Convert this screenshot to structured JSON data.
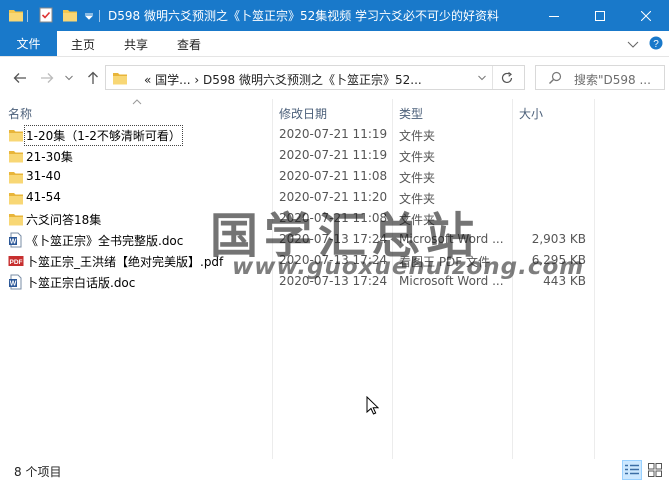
{
  "window": {
    "title": "D598 微明六爻预测之《卜筮正宗》52集视频 学习六爻必不可少的好资料",
    "accent": "#1979ca"
  },
  "ribbon": {
    "file_label": "文件",
    "tabs": [
      "主页",
      "共享",
      "查看"
    ]
  },
  "address": {
    "path": "« 国学... › D598 微明六爻预测之《卜筮正宗》52...",
    "search_placeholder": "搜索\"D598 ..."
  },
  "columns": {
    "name": "名称",
    "date": "修改日期",
    "type": "类型",
    "size": "大小"
  },
  "files": [
    {
      "name": "1-20集（1-2不够清晰可看）",
      "date": "2020-07-21 11:19",
      "type": "文件夹",
      "size": "",
      "icon": "folder-icon"
    },
    {
      "name": "21-30集",
      "date": "2020-07-21 11:19",
      "type": "文件夹",
      "size": "",
      "icon": "folder-icon"
    },
    {
      "name": "31-40",
      "date": "2020-07-21 11:08",
      "type": "文件夹",
      "size": "",
      "icon": "folder-icon"
    },
    {
      "name": "41-54",
      "date": "2020-07-21 11:20",
      "type": "文件夹",
      "size": "",
      "icon": "folder-icon"
    },
    {
      "name": "六爻问答18集",
      "date": "2020-07-21 11:08",
      "type": "文件夹",
      "size": "",
      "icon": "folder-icon"
    },
    {
      "name": "《卜筮正宗》全书完整版.doc",
      "date": "2020-07-13 17:24",
      "type": "Microsoft Word ...",
      "size": "2,903 KB",
      "icon": "word-doc-icon"
    },
    {
      "name": "卜筮正宗_王洪绪【绝对完美版】.pdf",
      "date": "2020-07-13 17:24",
      "type": "看图王 PDF 文件",
      "size": "6,295 KB",
      "icon": "pdf-icon"
    },
    {
      "name": "卜筮正宗白话版.doc",
      "date": "2020-07-13 17:24",
      "type": "Microsoft Word ...",
      "size": "443 KB",
      "icon": "word-doc-icon"
    }
  ],
  "status": {
    "count": "8 个项目"
  },
  "watermark": {
    "text": "国学汇总站",
    "url": "www.guoxuehuizong.com"
  }
}
